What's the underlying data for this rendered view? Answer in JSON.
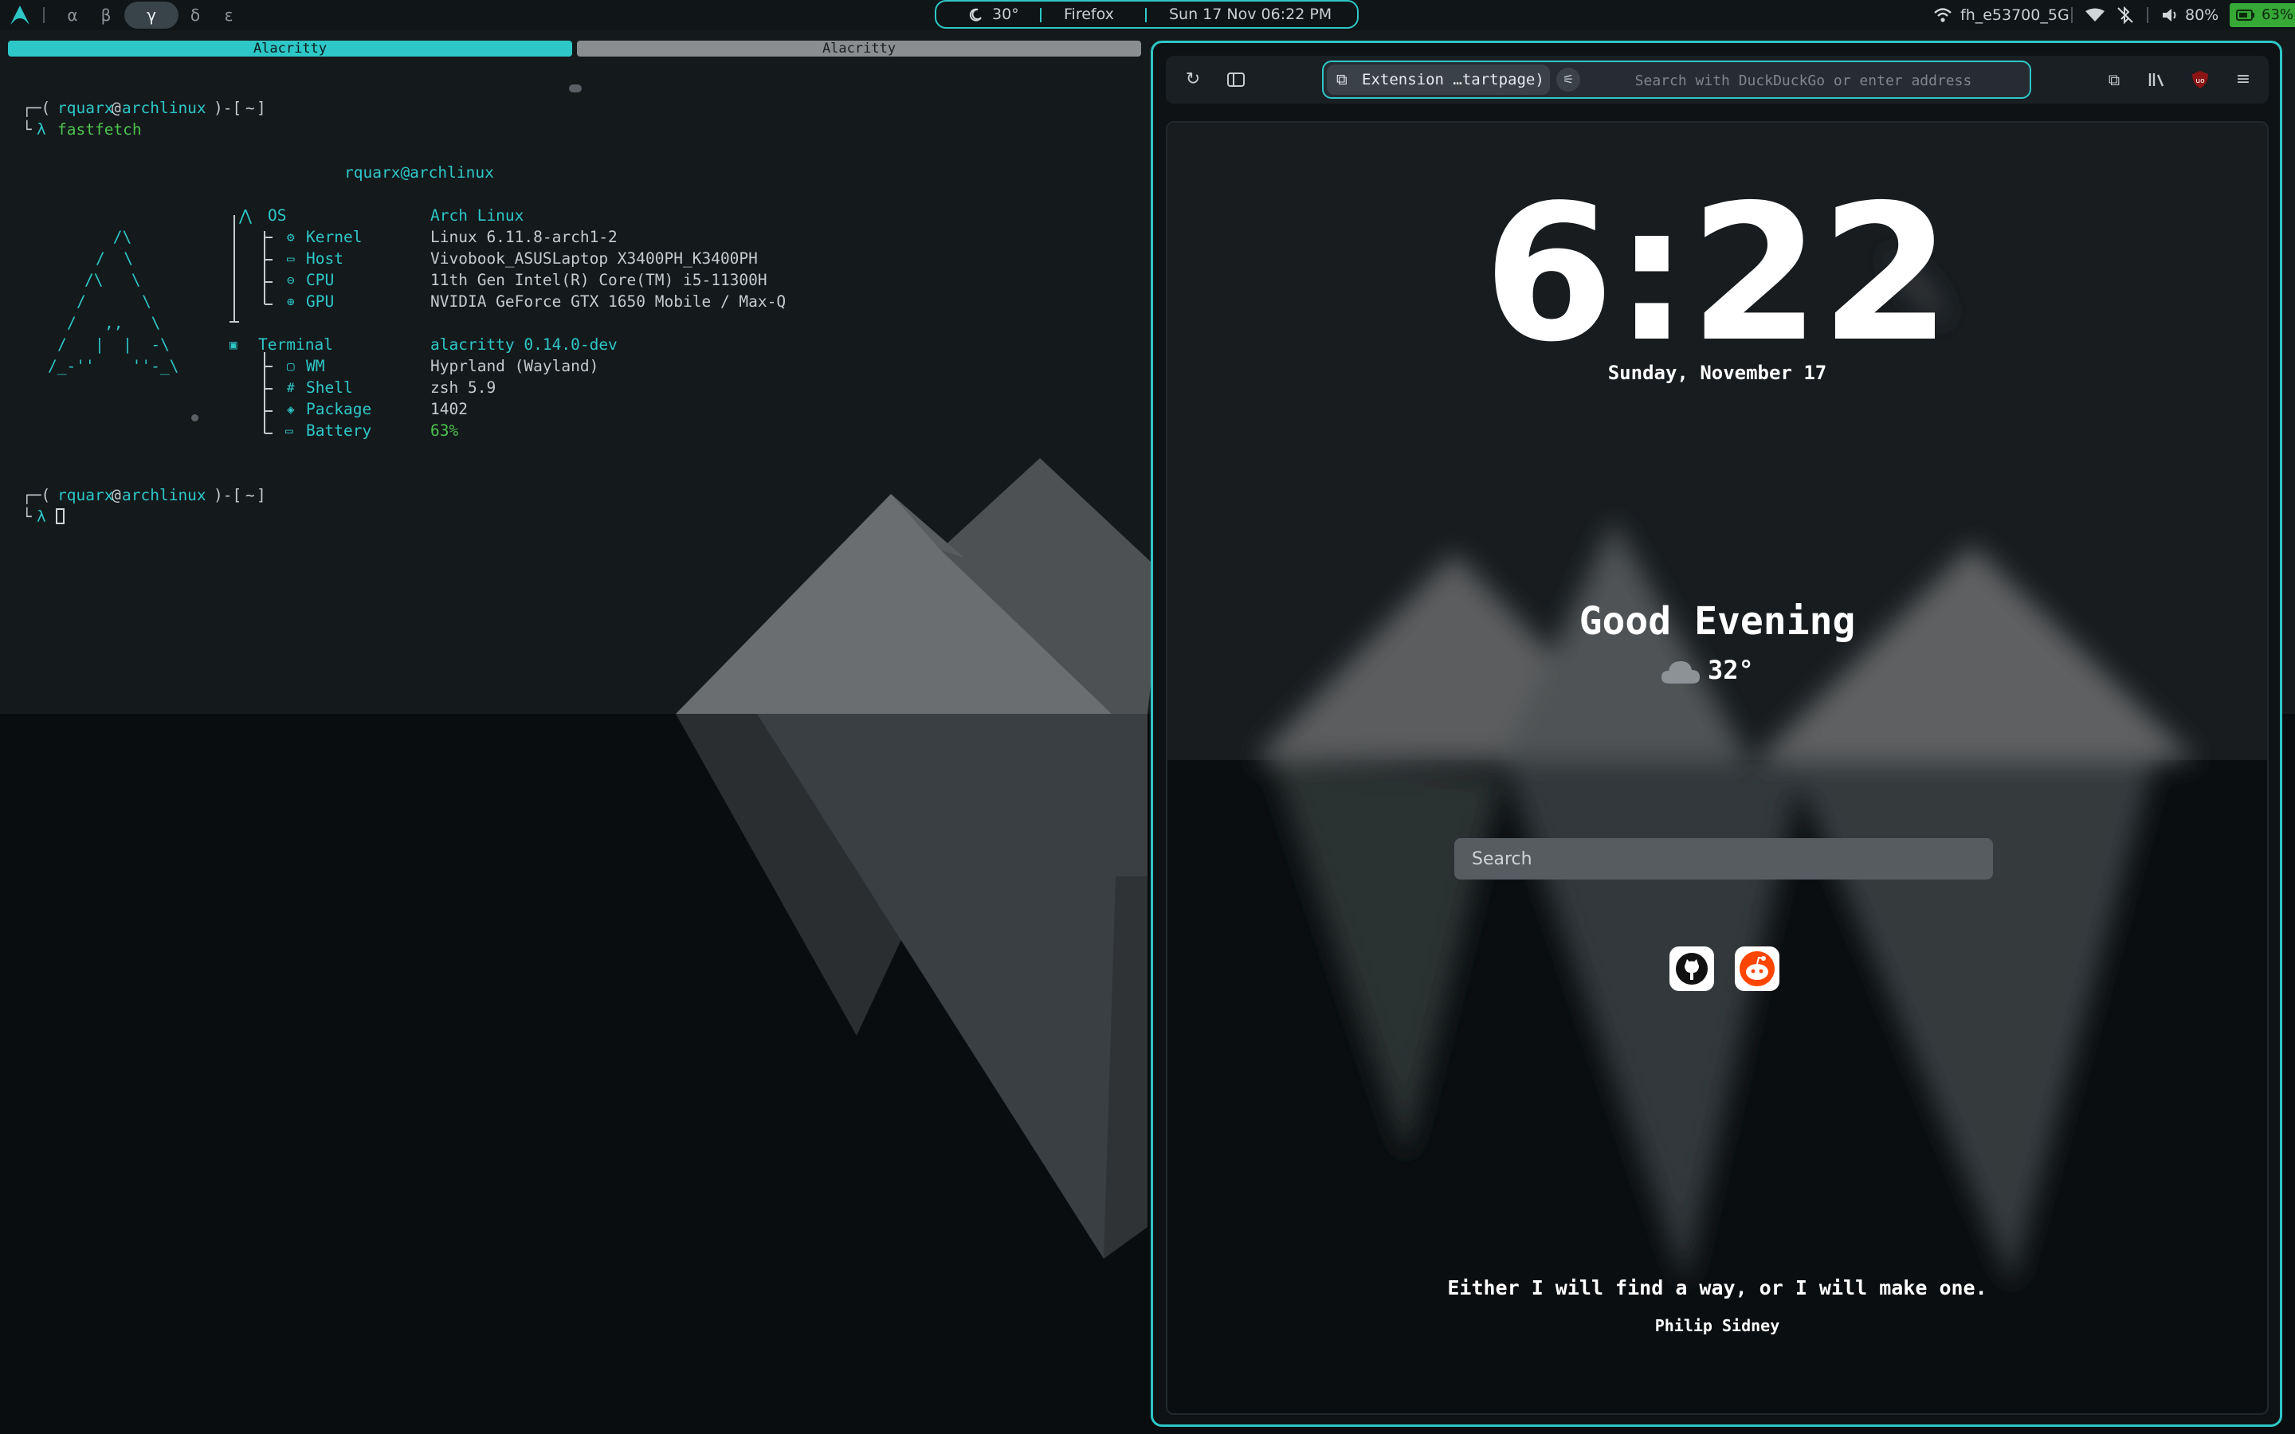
{
  "topbar": {
    "workspaces": [
      "α",
      "β",
      "γ",
      "δ",
      "ε"
    ],
    "active_workspace": "γ",
    "center": {
      "weather": "30°",
      "app": "Firefox",
      "datetime": "Sun 17 Nov 06:22 PM"
    },
    "network": "fh_e53700_5G",
    "volume": "80%",
    "battery": "63%"
  },
  "terminal": {
    "tabs": [
      "Alacritty",
      "Alacritty"
    ],
    "prompt": {
      "user": "rquarx",
      "host": "archlinux",
      "dir": "~"
    },
    "command": "fastfetch",
    "fetch_title": "rquarx@archlinux",
    "ascii_art": [
      " /\\",
      "/  \\",
      "/\\   \\",
      "/      \\",
      "/   ,,   \\",
      "/   |  |  -\\",
      "/_-''    ''-_\\"
    ],
    "section_system": {
      "header_label": "OS",
      "header_value": "Arch Linux",
      "rows": [
        {
          "label": "Kernel",
          "value": "Linux 6.11.8-arch1-2"
        },
        {
          "label": "Host",
          "value": "Vivobook_ASUSLaptop X3400PH_K3400PH"
        },
        {
          "label": "CPU",
          "value": "11th Gen Intel(R) Core(TM) i5-11300H"
        },
        {
          "label": "GPU",
          "value": "NVIDIA GeForce GTX 1650 Mobile / Max-Q"
        }
      ]
    },
    "section_terminal": {
      "header_label": "Terminal",
      "header_value": "alacritty 0.14.0-dev",
      "rows": [
        {
          "label": "WM",
          "value": "Hyprland (Wayland)"
        },
        {
          "label": "Shell",
          "value": "zsh 5.9"
        },
        {
          "label": "Package",
          "value": "1402"
        },
        {
          "label": "Battery",
          "value": "63%"
        }
      ]
    },
    "lambda": "λ"
  },
  "firefox": {
    "extension_chip": "Extension …tartpage)",
    "url_placeholder": "Search with DuckDuckGo or enter address",
    "startpage": {
      "clock": "6:22",
      "date": "Sunday, November 17",
      "greeting": "Good Evening",
      "temperature": "32°",
      "search_placeholder": "Search",
      "quote": "Either I will find a way, or I will make one.",
      "quote_author": "Philip Sidney",
      "quick_links": [
        "github-icon",
        "reddit-icon"
      ]
    }
  },
  "colors": {
    "accent": "#2ec7c7",
    "prompt_green": "#4cc24c",
    "battery_green": "#36a836"
  }
}
